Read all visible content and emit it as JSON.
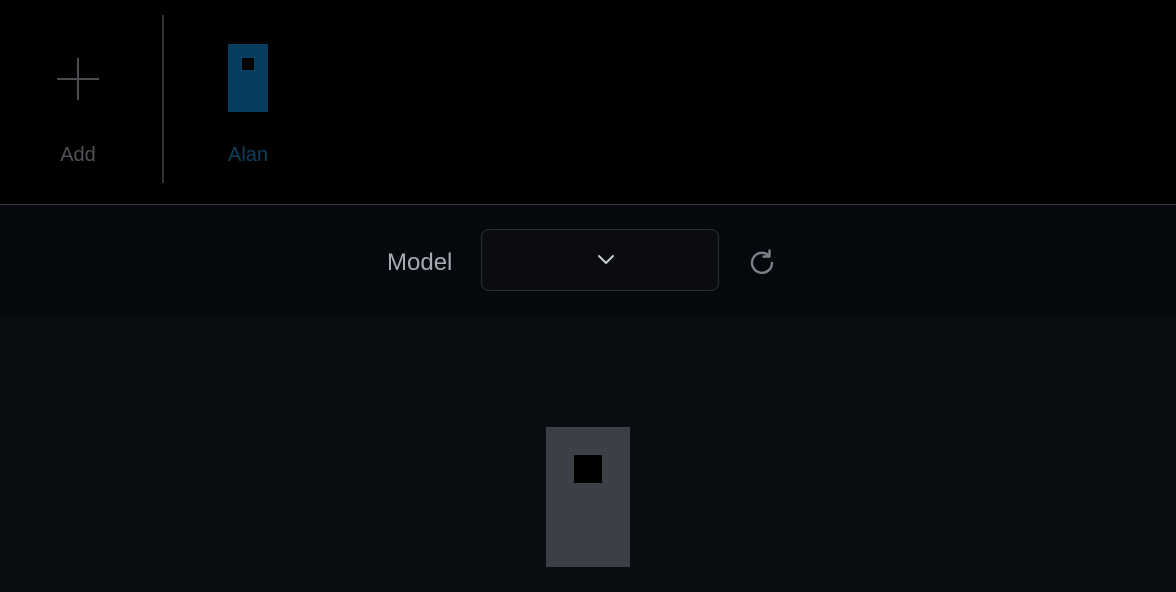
{
  "agents_bar": {
    "add_label": "Add",
    "add_icon": "plus-icon",
    "agents": [
      {
        "label": "Alan",
        "avatar_icon": "robot-avatar-icon",
        "color": "#073d5f",
        "label_color": "#0f3f5c"
      }
    ]
  },
  "model_bar": {
    "label": "Model",
    "selected_value": "",
    "dropdown_icon": "chevron-down-icon",
    "refresh_icon": "refresh-icon"
  },
  "main": {
    "avatar_icon": "robot-avatar-icon",
    "avatar_color": "#3c3f46"
  }
}
